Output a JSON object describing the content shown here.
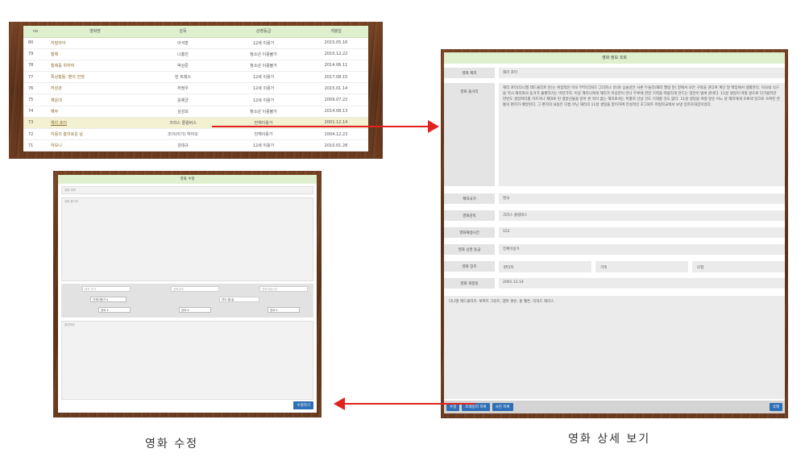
{
  "colors": {
    "arrow": "#e0231f",
    "header_bg": "#dff0cf",
    "button": "#2f6fb5",
    "wood": "#6b3b1f"
  },
  "list": {
    "columns": [
      "no",
      "영화명",
      "감독",
      "상영등급",
      "개봉일"
    ],
    "rows": [
      {
        "no": "80",
        "title": "히말라야",
        "director": "이석훈",
        "rating": "12세 이용가",
        "date": "2015.05.16"
      },
      {
        "no": "79",
        "title": "황해",
        "director": "나홍진",
        "rating": "청소년 이용불가",
        "date": "2010.12.22"
      },
      {
        "no": "78",
        "title": "황제를 위하여",
        "director": "박상준",
        "rating": "청소년 이용불가",
        "date": "2014.06.11"
      },
      {
        "no": "77",
        "title": "특상황들: 팬의 전쟁",
        "director": "한 트레스",
        "rating": "12세 이용가",
        "date": "2017.08.15"
      },
      {
        "no": "76",
        "title": "허삼관",
        "director": "하정우",
        "rating": "12세 이용가",
        "date": "2015.01.14"
      },
      {
        "no": "75",
        "title": "해운대",
        "director": "윤제균",
        "rating": "12세 이용가",
        "date": "2009.07.22"
      },
      {
        "no": "74",
        "title": "해무",
        "director": "심성보",
        "rating": "청소년 이용불가",
        "date": "2014.08.13"
      },
      {
        "no": "73",
        "title": "해리 포터",
        "director": "크리스 콜럼버스",
        "rating": "전체이용가",
        "date": "2001.12.14"
      },
      {
        "no": "72",
        "title": "자몽의 흥미로운 날",
        "director": "조이(이기) 하야오",
        "rating": "전체이용가",
        "date": "2004.12.23"
      },
      {
        "no": "71",
        "title": "하모니",
        "director": "강대규",
        "rating": "12세 이용가",
        "date": "2010.01.28"
      }
    ]
  },
  "detail": {
    "header": "영화 정보 조회",
    "labels": {
      "title": "영화 제목",
      "plot": "영화 줄거리",
      "country": "제작국가",
      "director": "영화감독",
      "runtime": "영화재생시간",
      "rating": "영화 상영 등급",
      "genre": "영화 장르",
      "release": "영화 개봉일"
    },
    "values": {
      "title": "해리 포터",
      "plot": "해리 포터(다니엘 래드클리프 분)는 위압적인 이모 부부(리처드 그리피스 분)와 심술궂은 사촌 두들리(해리 멜링 분) 밑에서 모든 구박을 견디며 계단 밑 벽장에서 생활한다. 이모네 식구들 역시 해리와의 동거가 불편하기는 마찬가지. 이상 해리니에게 해리가 이상한이 만나 부루에 관한 기적을 떠올리게 만드는 일만이 벌써 준비다. 11살 생일이 며칠 앞으로 다가왔지만 한번도 생일파티를 치르거나 제대로 된 생일선물을 받아 본 적이 없는 해리로서는 특별히 신날 것도 기대할 것도 없다. 11살 생일을 며칠 앞둔 어느 날 해리에게 초록색 잉크로 쓰여진 한 통의 편지가 배달된다. 그 편지의 내용은 다름 아닌 해리의 11살 생일을 맞이하여 전설적인 호그와트 마법학교에서 보낸 입학초대장이었다.",
      "country": "영국",
      "director": "크리스 콜럼버스",
      "runtime": "152",
      "rating": "전체이용가",
      "genre": [
        "판타지",
        "가족",
        "모험"
      ],
      "release": "2001.12.14",
      "cast": "다니엘 래드클리프, 루퍼트 그린트, 엠마 왓슨, 톰 펠튼, 리처드 해리스"
    },
    "buttons": {
      "edit": "수정",
      "trailer": "트레일러 목록",
      "photos": "사진 목록",
      "delete": "삭제"
    }
  },
  "edit": {
    "header": "영화 수정",
    "title_placeholder": "영화 제목",
    "plot_placeholder": "영화 줄거리",
    "small_placeholders": [
      "제작 국가",
      "영화감독",
      "영화재생시간"
    ],
    "selects": [
      "전체이용가",
      "장르",
      "장르",
      "장르"
    ],
    "date_value": "연도-월-일",
    "cast_placeholder": "출연배우",
    "save_label": "수정하기"
  },
  "captions": {
    "left": "영화 수정",
    "right": "영화 상세 보기"
  }
}
